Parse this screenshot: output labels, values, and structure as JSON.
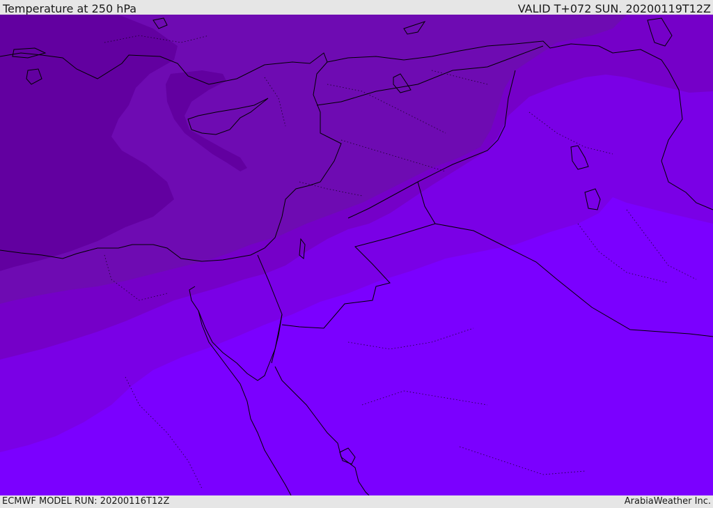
{
  "header": {
    "title": "Temperature at 250 hPa",
    "valid": "VALID T+072 SUN. 20200119T12Z"
  },
  "footer": {
    "model_run": "ECMWF MODEL RUN: 20200116T12Z",
    "credit": "ArabiaWeather Inc."
  },
  "colors": {
    "band_coldest": "#6200a0",
    "band_cold": "#6e0bb2",
    "band_mid": "#7500c8",
    "band_warm": "#7a00e6",
    "band_warmest": "#7b00ff",
    "coastline": "#000000"
  }
}
